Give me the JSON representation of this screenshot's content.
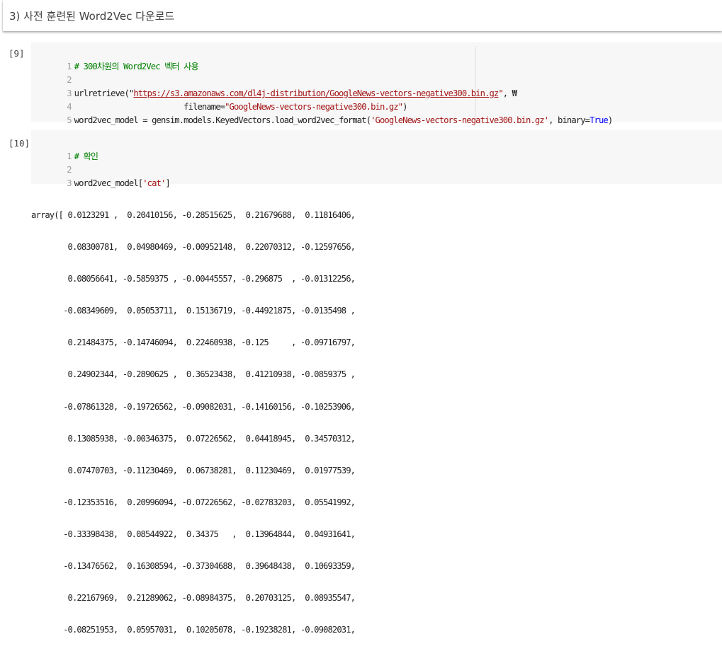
{
  "markdown": {
    "heading": "3) 사전 훈련된 Word2Vec 다운로드"
  },
  "cell1": {
    "exec_count": "[9]",
    "lines": [
      {
        "n": "1",
        "comment": "# 300차원의 Word2Vec 벡터 사용"
      },
      {
        "n": "2"
      },
      {
        "n": "3",
        "pre": "urlretrieve(\"",
        "url": "https://s3.amazonaws.com/dl4j-distribution/GoogleNews-vectors-negative300.bin.gz",
        "post_str": "\"",
        "post": ", ₩"
      },
      {
        "n": "4",
        "pre": "                        filename=",
        "str": "\"GoogleNews-vectors-negative300.bin.gz\"",
        "post": ")"
      },
      {
        "n": "5",
        "pre": "word2vec_model = gensim.models.KeyedVectors.load_word2vec_format(",
        "str": "'GoogleNews-vectors-negative300.bin.gz'",
        "post": ", binary=",
        "kw": "True",
        "post2": ")"
      }
    ]
  },
  "cell2": {
    "exec_count": "[10]",
    "lines": [
      {
        "n": "1",
        "comment": "# 확인"
      },
      {
        "n": "2"
      },
      {
        "n": "3",
        "pre": "word2vec_model[",
        "str": "'cat'",
        "post": "]"
      }
    ]
  },
  "output": {
    "lines": [
      "array([ 0.0123291 ,  0.20410156, -0.28515625,  0.21679688,  0.11816406,",
      "        0.08300781,  0.04980469, -0.00952148,  0.22070312, -0.12597656,",
      "        0.08056641, -0.5859375 , -0.00445557, -0.296875  , -0.01312256,",
      "       -0.08349609,  0.05053711,  0.15136719, -0.44921875, -0.0135498 ,",
      "        0.21484375, -0.14746094,  0.22460938, -0.125     , -0.09716797,",
      "        0.24902344, -0.2890625 ,  0.36523438,  0.41210938, -0.0859375 ,",
      "       -0.07861328, -0.19726562, -0.09082031, -0.14160156, -0.10253906,",
      "        0.13085938, -0.00346375,  0.07226562,  0.04418945,  0.34570312,",
      "        0.07470703, -0.11230469,  0.06738281,  0.11230469,  0.01977539,",
      "       -0.12353516,  0.20996094, -0.07226562, -0.02783203,  0.05541992,",
      "       -0.33398438,  0.08544922,  0.34375   ,  0.13964844,  0.04931641,",
      "       -0.13476562,  0.16308594, -0.37304688,  0.39648438,  0.10693359,",
      "        0.22167969,  0.21289062, -0.08984375,  0.20703125,  0.08935547,",
      "       -0.08251953,  0.05957031,  0.10205078, -0.19238281, -0.09082031,"
    ]
  }
}
